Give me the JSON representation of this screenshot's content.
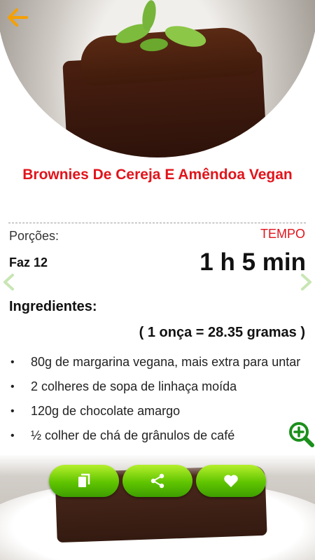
{
  "recipe": {
    "title": "Brownies De Cereja E Amêndoa Vegan",
    "servings_label": "Porções:",
    "servings_value": "Faz 12",
    "time_label": "TEMPO",
    "time_value": "1 h 5 min"
  },
  "ingredients": {
    "heading": "Ingredientes:",
    "conversion": "( 1 onça = 28.35 gramas )",
    "items": [
      "80g de margarina vegana, mais extra para untar",
      "2 colheres de sopa de linhaça moída",
      "120g de chocolate amargo",
      "½ colher de chá de grânulos de café"
    ]
  },
  "icons": {
    "back": "arrow-left-icon",
    "prev": "chevron-left-icon",
    "next": "chevron-right-icon",
    "zoom": "zoom-in-icon",
    "copy": "copy-icon",
    "share": "share-icon",
    "favorite": "heart-icon"
  },
  "colors": {
    "title": "#e1141b",
    "time_label": "#e1141b",
    "button_green": "#5fc400",
    "zoom_green": "#1b8f1b",
    "back_arrow": "#f5a000"
  }
}
